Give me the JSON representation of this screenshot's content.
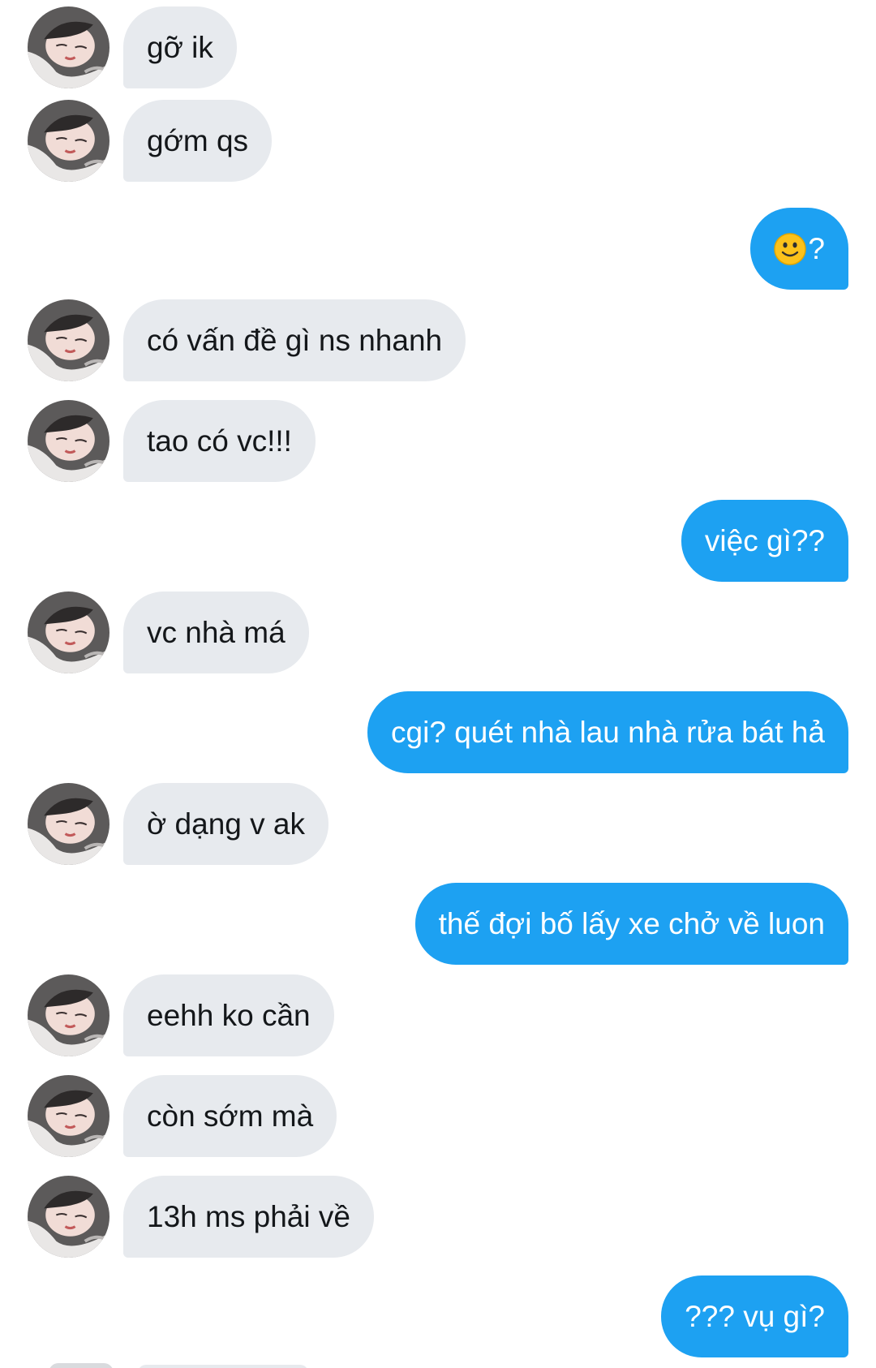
{
  "conversation": {
    "messages": [
      {
        "direction": "incoming",
        "text": "gỡ ik"
      },
      {
        "direction": "incoming",
        "text": "gớm qs"
      },
      {
        "direction": "outgoing",
        "emoji": "slightly-smiling-face-icon",
        "text": "?"
      },
      {
        "direction": "incoming",
        "text": "có vấn đề gì ns nhanh"
      },
      {
        "direction": "incoming",
        "text": "tao có vc!!!"
      },
      {
        "direction": "outgoing",
        "text": "việc gì??"
      },
      {
        "direction": "incoming",
        "text": "vc nhà má"
      },
      {
        "direction": "outgoing",
        "text": "cgi? quét nhà lau nhà rửa bát hả"
      },
      {
        "direction": "incoming",
        "text": "ờ dạng v ak"
      },
      {
        "direction": "outgoing",
        "text": "thế đợi bố lấy xe chở về luon"
      },
      {
        "direction": "incoming",
        "text": "eehh ko cần"
      },
      {
        "direction": "incoming",
        "text": "còn sớm mà"
      },
      {
        "direction": "incoming",
        "text": "13h ms phải về"
      },
      {
        "direction": "outgoing",
        "text": "??? vụ gì?"
      }
    ]
  },
  "colors": {
    "background": "#ffffff",
    "incoming_bubble": "#e7eaee",
    "incoming_text": "#14171a",
    "outgoing_bubble": "#1da1f2",
    "outgoing_text": "#ffffff"
  }
}
